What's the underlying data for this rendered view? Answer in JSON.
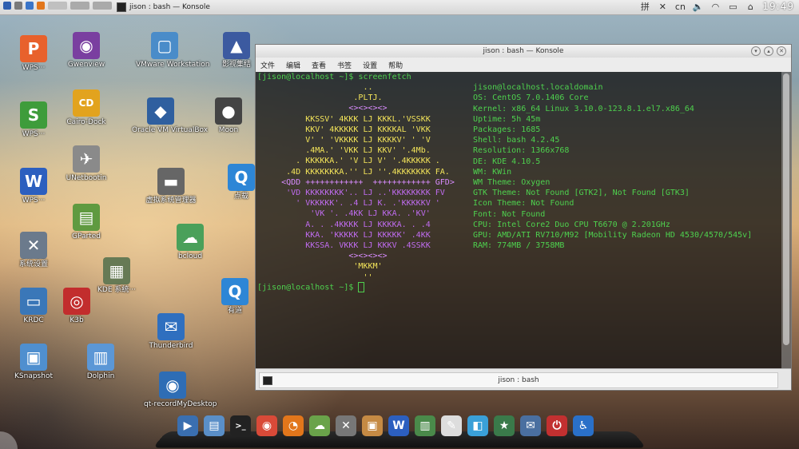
{
  "top_panel": {
    "task_title": "jison : bash — Konsole",
    "input_method": "cn",
    "clock": "19:49"
  },
  "desktop": {
    "icons": [
      {
        "label": "WPS···",
        "glyph": "P",
        "color": "#e8612c"
      },
      {
        "label": "WPS···",
        "glyph": "S",
        "color": "#3e9c3b"
      },
      {
        "label": "WPS···",
        "glyph": "W",
        "color": "#2c5fbf"
      },
      {
        "label": "系统设置",
        "glyph": "✕",
        "color": "#6b7a8c"
      },
      {
        "label": "KRDC",
        "glyph": "▭",
        "color": "#3a77b8"
      },
      {
        "label": "KSnapshot",
        "glyph": "▣",
        "color": "#4f8fcf"
      },
      {
        "label": "Gwenview",
        "glyph": "◉",
        "color": "#7a3fa0"
      },
      {
        "label": "Cairo-Dock",
        "glyph": "CD",
        "color": "#e2a31e"
      },
      {
        "label": "UNetbootin",
        "glyph": "✈",
        "color": "#8a8a8a"
      },
      {
        "label": "GParted",
        "glyph": "▤",
        "color": "#5f9a40"
      },
      {
        "label": "K3b",
        "glyph": "◎",
        "color": "#c22d2d"
      },
      {
        "label": "Dolphin",
        "glyph": "▥",
        "color": "#5b97d6"
      },
      {
        "label": "VMware Workstation",
        "glyph": "▢",
        "color": "#4a8cc9"
      },
      {
        "label": "Oracle VM VirtualBox",
        "glyph": "◆",
        "color": "#2f5f9f"
      },
      {
        "label": "虚拟系统管理器",
        "glyph": "▬",
        "color": "#666"
      },
      {
        "label": "KDE 系统···",
        "glyph": "▦",
        "color": "#667a55"
      },
      {
        "label": "Thunderbird",
        "glyph": "✉",
        "color": "#2f6fbf"
      },
      {
        "label": "qt-recordMyDesktop",
        "glyph": "◉",
        "color": "#2e6db5"
      },
      {
        "label": "影视集结",
        "glyph": "▲",
        "color": "#3c5aa0"
      },
      {
        "label": "Moon",
        "glyph": "●",
        "color": "#444"
      },
      {
        "label": "点载",
        "glyph": "Q",
        "color": "#2d86d6"
      },
      {
        "label": "bcloud",
        "glyph": "☁",
        "color": "#4aa05a"
      },
      {
        "label": "有道",
        "glyph": "Q",
        "color": "#2d86d6"
      }
    ]
  },
  "konsole": {
    "title": "jison : bash — Konsole",
    "menu": [
      "文件",
      "编辑",
      "查看",
      "书签",
      "设置",
      "帮助"
    ],
    "tab_label": "jison : bash",
    "prompt": "[jison@localhost ~]$ ",
    "command": "screenfetch",
    "final_prompt": "[jison@localhost ~]$ ",
    "logo_lines": [
      [
        "                      ..                        "
      ],
      [
        "                    .PLTJ.                      "
      ],
      [
        "                   <><><><>                     "
      ],
      [
        "          KKSSV' 4KKK LJ KKKL.'VSSKK            "
      ],
      [
        "          KKV' 4KKKKK LJ KKKKAL 'VKK            "
      ],
      [
        "          V' ' 'VKKKK LJ KKKKV' ' 'V            "
      ],
      [
        "          .4MA.' 'VKK LJ KKV' '.4Mb.            "
      ],
      [
        "        . KKKKKA.' 'V LJ V' '.4KKKKK .          "
      ],
      [
        "      .4D KKKKKKKA.'' LJ ''.4KKKKKKK FA.        "
      ],
      [
        "     <QDD ++++++++++++  ++++++++++++ GFD>       "
      ],
      [
        "      'VD KKKKKKKK'.. LJ ..'KKKKKKKK FV         "
      ],
      [
        "        ' VKKKKK'. .4 LJ K. .'KKKKKV '          "
      ],
      [
        "           'VK '. .4KK LJ KKA. .'KV'            "
      ],
      [
        "          A. . .4KKKK LJ KKKKA. . .4            "
      ],
      [
        "          KKA. 'KKKKK LJ KKKKK' .4KK            "
      ],
      [
        "          KKSSA. VKKK LJ KKKV .4SSKK            "
      ],
      [
        "                   <><><><>                     "
      ],
      [
        "                    'MKKM'                      "
      ],
      [
        "                      ''                        "
      ]
    ],
    "info": {
      "header": "jison@localhost.localdomain",
      "lines": [
        {
          "key": "OS: ",
          "value": "CentOS 7.0.1406 Core"
        },
        {
          "key": "Kernel: ",
          "value": "x86_64 Linux 3.10.0-123.8.1.el7.x86_64"
        },
        {
          "key": "Uptime: ",
          "value": "5h 45m"
        },
        {
          "key": "Packages: ",
          "value": "1685"
        },
        {
          "key": "Shell: ",
          "value": "bash 4.2.45"
        },
        {
          "key": "Resolution: ",
          "value": "1366x768"
        },
        {
          "key": "DE: ",
          "value": "KDE 4.10.5"
        },
        {
          "key": "WM: ",
          "value": "KWin"
        },
        {
          "key": "WM Theme: ",
          "value": "Oxygen"
        },
        {
          "key": "GTK Theme: ",
          "value": "Not Found [GTK2], Not Found [GTK3]"
        },
        {
          "key": "Icon Theme: ",
          "value": "Not Found"
        },
        {
          "key": "Font: ",
          "value": "Not Found"
        },
        {
          "key": "CPU: ",
          "value": "Intel Core2 Duo CPU T6670 @ 2.201GHz"
        },
        {
          "key": "GPU: ",
          "value": "AMD/ATI RV710/M92 [Mobility Radeon HD 4530/4570/545v]"
        },
        {
          "key": "RAM: ",
          "value": "774MB / 3758MB"
        }
      ]
    }
  },
  "dock": {
    "items": [
      {
        "name": "media-player",
        "glyph": "▶",
        "color": "#3a6fb0"
      },
      {
        "name": "file-manager",
        "glyph": "▤",
        "color": "#5a8fc8"
      },
      {
        "name": "terminal",
        "glyph": ">_",
        "color": "#222"
      },
      {
        "name": "chrome",
        "glyph": "◉",
        "color": "#d94a38"
      },
      {
        "name": "firefox",
        "glyph": "◔",
        "color": "#e2761b"
      },
      {
        "name": "bcloud",
        "glyph": "☁",
        "color": "#6aa34a"
      },
      {
        "name": "settings-tools",
        "glyph": "✕",
        "color": "#777"
      },
      {
        "name": "package",
        "glyph": "▣",
        "color": "#c58a44"
      },
      {
        "name": "wps-writer",
        "glyph": "W",
        "color": "#2c5fbf"
      },
      {
        "name": "library",
        "glyph": "▥",
        "color": "#4a8a4a"
      },
      {
        "name": "editor",
        "glyph": "✎",
        "color": "#ddd"
      },
      {
        "name": "notes",
        "glyph": "◧",
        "color": "#3aa0d8"
      },
      {
        "name": "stardict",
        "glyph": "★",
        "color": "#3a7a4a"
      },
      {
        "name": "mail",
        "glyph": "✉",
        "color": "#4a6fa0"
      },
      {
        "name": "shutdown",
        "glyph": "⏻",
        "color": "#c23030"
      },
      {
        "name": "accessibility",
        "glyph": "♿",
        "color": "#2a70c8"
      }
    ]
  }
}
